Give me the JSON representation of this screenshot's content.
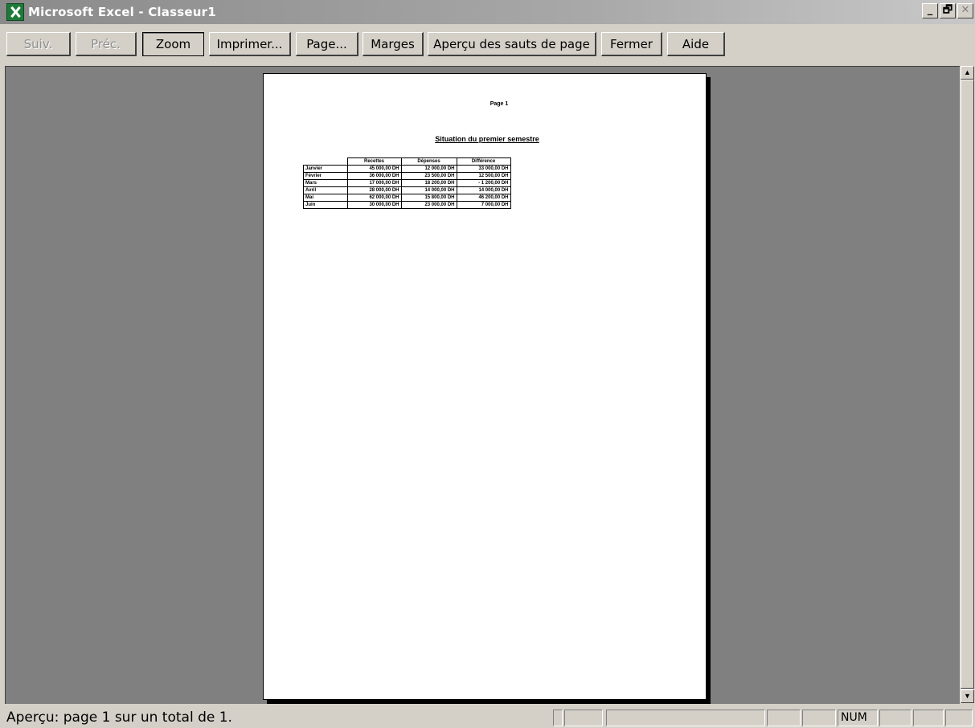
{
  "window": {
    "title": "Microsoft Excel - Classeur1",
    "controls": {
      "minimize": "_",
      "restore": "🗗",
      "close": "✕"
    }
  },
  "toolbar": {
    "next": "Suiv.",
    "prev": "Préc.",
    "zoom": "Zoom",
    "print": "Imprimer...",
    "page": "Page...",
    "margins": "Marges",
    "page_break": "Aperçu des sauts de page",
    "close": "Fermer",
    "help": "Aide"
  },
  "sheet": {
    "header": "Page 1",
    "title": "Situation du premier semestre",
    "columns": [
      "Recettes",
      "Dépenses",
      "Différence"
    ],
    "rows": [
      {
        "month": "Janvier",
        "recettes": "45 000,00 DH",
        "depenses": "12 000,00 DH",
        "difference": "33 000,00 DH"
      },
      {
        "month": "Février",
        "recettes": "36 000,00 DH",
        "depenses": "23 500,00 DH",
        "difference": "12 500,00 DH"
      },
      {
        "month": "Mars",
        "recettes": "17 000,00 DH",
        "depenses": "18 200,00 DH",
        "difference": "- 1 200,00 DH"
      },
      {
        "month": "Avril",
        "recettes": "28 000,00 DH",
        "depenses": "14 000,00 DH",
        "difference": "14 000,00 DH"
      },
      {
        "month": "Mai",
        "recettes": "62 000,00 DH",
        "depenses": "15 800,00 DH",
        "difference": "46 200,00 DH"
      },
      {
        "month": "Juin",
        "recettes": "30 000,00 DH",
        "depenses": "23 000,00 DH",
        "difference": "7 000,00 DH"
      }
    ]
  },
  "statusbar": {
    "message": "Aperçu: page 1 sur un total de 1.",
    "num": "NUM"
  }
}
